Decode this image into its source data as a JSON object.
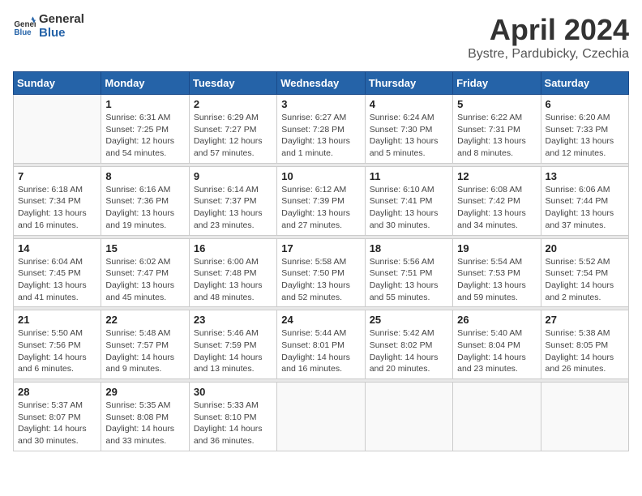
{
  "header": {
    "logo_text_general": "General",
    "logo_text_blue": "Blue",
    "month_title": "April 2024",
    "location": "Bystre, Pardubicky, Czechia"
  },
  "calendar": {
    "days_of_week": [
      "Sunday",
      "Monday",
      "Tuesday",
      "Wednesday",
      "Thursday",
      "Friday",
      "Saturday"
    ],
    "weeks": [
      [
        {
          "day": "",
          "info": ""
        },
        {
          "day": "1",
          "info": "Sunrise: 6:31 AM\nSunset: 7:25 PM\nDaylight: 12 hours\nand 54 minutes."
        },
        {
          "day": "2",
          "info": "Sunrise: 6:29 AM\nSunset: 7:27 PM\nDaylight: 12 hours\nand 57 minutes."
        },
        {
          "day": "3",
          "info": "Sunrise: 6:27 AM\nSunset: 7:28 PM\nDaylight: 13 hours\nand 1 minute."
        },
        {
          "day": "4",
          "info": "Sunrise: 6:24 AM\nSunset: 7:30 PM\nDaylight: 13 hours\nand 5 minutes."
        },
        {
          "day": "5",
          "info": "Sunrise: 6:22 AM\nSunset: 7:31 PM\nDaylight: 13 hours\nand 8 minutes."
        },
        {
          "day": "6",
          "info": "Sunrise: 6:20 AM\nSunset: 7:33 PM\nDaylight: 13 hours\nand 12 minutes."
        }
      ],
      [
        {
          "day": "7",
          "info": "Sunrise: 6:18 AM\nSunset: 7:34 PM\nDaylight: 13 hours\nand 16 minutes."
        },
        {
          "day": "8",
          "info": "Sunrise: 6:16 AM\nSunset: 7:36 PM\nDaylight: 13 hours\nand 19 minutes."
        },
        {
          "day": "9",
          "info": "Sunrise: 6:14 AM\nSunset: 7:37 PM\nDaylight: 13 hours\nand 23 minutes."
        },
        {
          "day": "10",
          "info": "Sunrise: 6:12 AM\nSunset: 7:39 PM\nDaylight: 13 hours\nand 27 minutes."
        },
        {
          "day": "11",
          "info": "Sunrise: 6:10 AM\nSunset: 7:41 PM\nDaylight: 13 hours\nand 30 minutes."
        },
        {
          "day": "12",
          "info": "Sunrise: 6:08 AM\nSunset: 7:42 PM\nDaylight: 13 hours\nand 34 minutes."
        },
        {
          "day": "13",
          "info": "Sunrise: 6:06 AM\nSunset: 7:44 PM\nDaylight: 13 hours\nand 37 minutes."
        }
      ],
      [
        {
          "day": "14",
          "info": "Sunrise: 6:04 AM\nSunset: 7:45 PM\nDaylight: 13 hours\nand 41 minutes."
        },
        {
          "day": "15",
          "info": "Sunrise: 6:02 AM\nSunset: 7:47 PM\nDaylight: 13 hours\nand 45 minutes."
        },
        {
          "day": "16",
          "info": "Sunrise: 6:00 AM\nSunset: 7:48 PM\nDaylight: 13 hours\nand 48 minutes."
        },
        {
          "day": "17",
          "info": "Sunrise: 5:58 AM\nSunset: 7:50 PM\nDaylight: 13 hours\nand 52 minutes."
        },
        {
          "day": "18",
          "info": "Sunrise: 5:56 AM\nSunset: 7:51 PM\nDaylight: 13 hours\nand 55 minutes."
        },
        {
          "day": "19",
          "info": "Sunrise: 5:54 AM\nSunset: 7:53 PM\nDaylight: 13 hours\nand 59 minutes."
        },
        {
          "day": "20",
          "info": "Sunrise: 5:52 AM\nSunset: 7:54 PM\nDaylight: 14 hours\nand 2 minutes."
        }
      ],
      [
        {
          "day": "21",
          "info": "Sunrise: 5:50 AM\nSunset: 7:56 PM\nDaylight: 14 hours\nand 6 minutes."
        },
        {
          "day": "22",
          "info": "Sunrise: 5:48 AM\nSunset: 7:57 PM\nDaylight: 14 hours\nand 9 minutes."
        },
        {
          "day": "23",
          "info": "Sunrise: 5:46 AM\nSunset: 7:59 PM\nDaylight: 14 hours\nand 13 minutes."
        },
        {
          "day": "24",
          "info": "Sunrise: 5:44 AM\nSunset: 8:01 PM\nDaylight: 14 hours\nand 16 minutes."
        },
        {
          "day": "25",
          "info": "Sunrise: 5:42 AM\nSunset: 8:02 PM\nDaylight: 14 hours\nand 20 minutes."
        },
        {
          "day": "26",
          "info": "Sunrise: 5:40 AM\nSunset: 8:04 PM\nDaylight: 14 hours\nand 23 minutes."
        },
        {
          "day": "27",
          "info": "Sunrise: 5:38 AM\nSunset: 8:05 PM\nDaylight: 14 hours\nand 26 minutes."
        }
      ],
      [
        {
          "day": "28",
          "info": "Sunrise: 5:37 AM\nSunset: 8:07 PM\nDaylight: 14 hours\nand 30 minutes."
        },
        {
          "day": "29",
          "info": "Sunrise: 5:35 AM\nSunset: 8:08 PM\nDaylight: 14 hours\nand 33 minutes."
        },
        {
          "day": "30",
          "info": "Sunrise: 5:33 AM\nSunset: 8:10 PM\nDaylight: 14 hours\nand 36 minutes."
        },
        {
          "day": "",
          "info": ""
        },
        {
          "day": "",
          "info": ""
        },
        {
          "day": "",
          "info": ""
        },
        {
          "day": "",
          "info": ""
        }
      ]
    ]
  }
}
